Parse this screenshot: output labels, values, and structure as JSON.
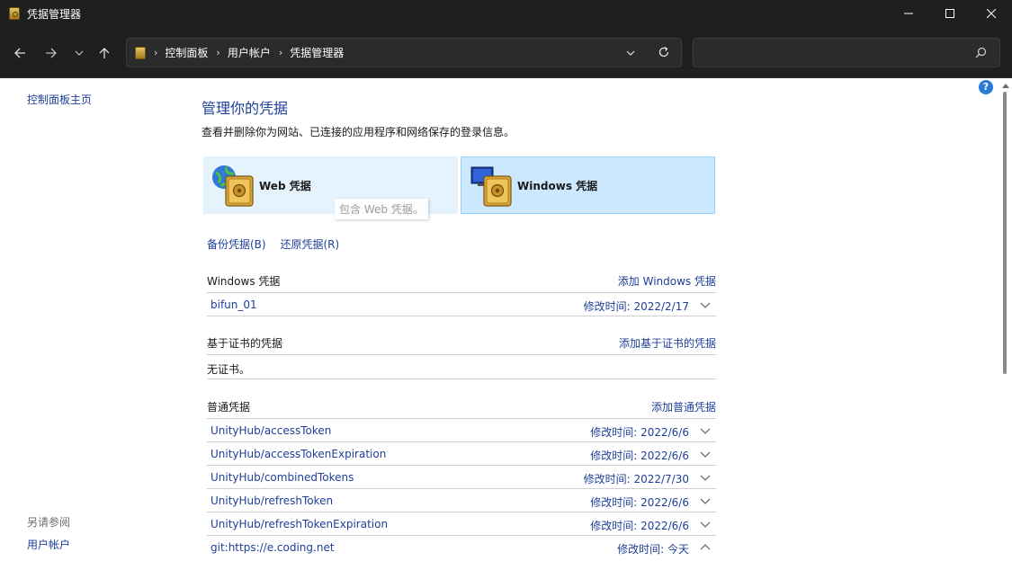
{
  "window": {
    "title": "凭据管理器"
  },
  "address": {
    "crumbs": [
      "控制面板",
      "用户帐户",
      "凭据管理器"
    ],
    "search_placeholder": ""
  },
  "left": {
    "home": "控制面板主页",
    "see_also": "另请参阅",
    "accounts": "用户帐户"
  },
  "main": {
    "title": "管理你的凭据",
    "subtitle": "查看并删除你为网站、已连接的应用程序和网络保存的登录信息。",
    "tiles": {
      "web": "Web 凭据",
      "windows": "Windows 凭据",
      "tooltip": "包含 Web 凭据。"
    },
    "backup": "备份凭据(B)",
    "restore": "还原凭据(R)",
    "windows_section": {
      "title": "Windows 凭据",
      "add": "添加 Windows 凭据",
      "items": [
        {
          "name": "bifun_01",
          "modified_label": "修改时间:",
          "date": "2022/2/17"
        }
      ]
    },
    "cert_section": {
      "title": "基于证书的凭据",
      "add": "添加基于证书的凭据",
      "empty": "无证书。"
    },
    "generic_section": {
      "title": "普通凭据",
      "add": "添加普通凭据",
      "items": [
        {
          "name": "UnityHub/accessToken",
          "modified_label": "修改时间:",
          "date": "2022/6/6",
          "expanded": false
        },
        {
          "name": "UnityHub/accessTokenExpiration",
          "modified_label": "修改时间:",
          "date": "2022/6/6",
          "expanded": false
        },
        {
          "name": "UnityHub/combinedTokens",
          "modified_label": "修改时间:",
          "date": "2022/7/30",
          "expanded": false
        },
        {
          "name": "UnityHub/refreshToken",
          "modified_label": "修改时间:",
          "date": "2022/6/6",
          "expanded": false
        },
        {
          "name": "UnityHub/refreshTokenExpiration",
          "modified_label": "修改时间:",
          "date": "2022/6/6",
          "expanded": false
        },
        {
          "name": "git:https://e.coding.net",
          "modified_label": "修改时间:",
          "date": "今天",
          "expanded": true
        }
      ]
    }
  },
  "colors": {
    "link": "#1e3f99",
    "titlebar": "#1f1f1f",
    "tile_selected": "#cce8ff"
  }
}
